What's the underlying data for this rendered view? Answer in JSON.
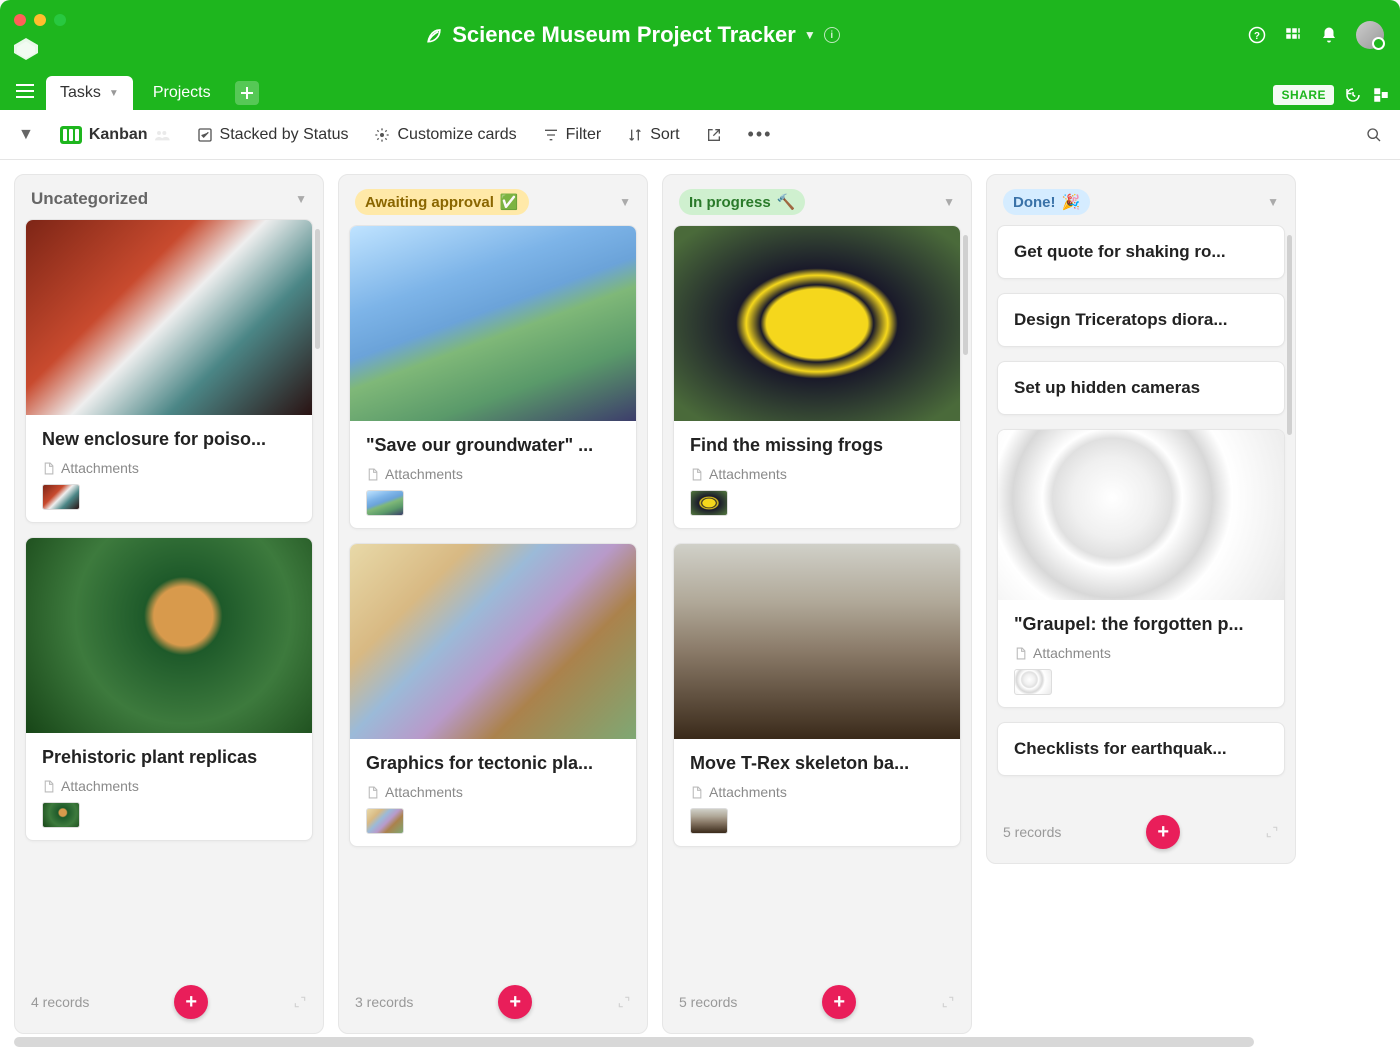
{
  "header": {
    "title": "Science Museum Project Tracker"
  },
  "tabs": {
    "active": "Tasks",
    "items": [
      "Tasks",
      "Projects"
    ]
  },
  "share_label": "SHARE",
  "toolbar": {
    "view_label": "Kanban",
    "stacked": "Stacked by Status",
    "customize": "Customize cards",
    "filter": "Filter",
    "sort": "Sort"
  },
  "columns": [
    {
      "title": "Uncategorized",
      "pill": null,
      "records_label": "4 records",
      "cards": [
        {
          "title": "New enclosure for poiso...",
          "attachments_label": "Attachments",
          "img": "img-frog1"
        },
        {
          "title": "Prehistoric plant replicas",
          "attachments_label": "Attachments",
          "img": "img-plant"
        }
      ]
    },
    {
      "title": "Awaiting approval",
      "pill": "yellow",
      "emoji": "✅",
      "records_label": "3 records",
      "cards": [
        {
          "title": "\"Save our groundwater\" ...",
          "attachments_label": "Attachments",
          "img": "img-water"
        },
        {
          "title": "Graphics for tectonic pla...",
          "attachments_label": "Attachments",
          "img": "img-plates"
        }
      ]
    },
    {
      "title": "In progress",
      "pill": "green",
      "emoji": "🔨",
      "records_label": "5 records",
      "cards": [
        {
          "title": "Find the missing frogs",
          "attachments_label": "Attachments",
          "img": "img-frog2"
        },
        {
          "title": "Move T-Rex skeleton ba...",
          "attachments_label": "Attachments",
          "img": "img-trex"
        }
      ]
    },
    {
      "title": "Done!",
      "pill": "blue",
      "emoji": "🎉",
      "records_label": "5 records",
      "simple_cards": [
        "Get quote for shaking ro...",
        "Design Triceratops diora...",
        "Set up hidden cameras"
      ],
      "cards": [
        {
          "title": "\"Graupel: the forgotten p...",
          "attachments_label": "Attachments",
          "img": "img-graupel"
        }
      ],
      "trailing_simple": [
        "Checklists for earthquak..."
      ]
    }
  ]
}
